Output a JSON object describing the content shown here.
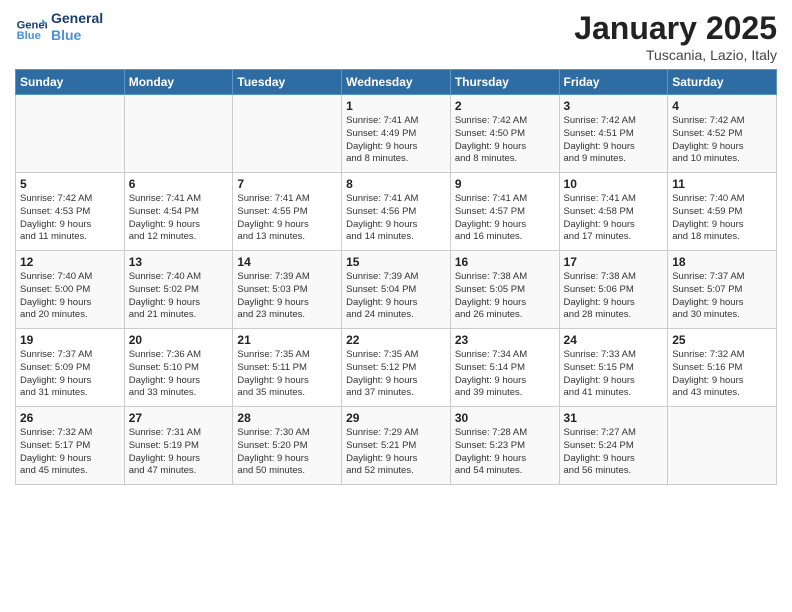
{
  "header": {
    "logo_line1": "General",
    "logo_line2": "Blue",
    "month": "January 2025",
    "location": "Tuscania, Lazio, Italy"
  },
  "weekdays": [
    "Sunday",
    "Monday",
    "Tuesday",
    "Wednesday",
    "Thursday",
    "Friday",
    "Saturday"
  ],
  "weeks": [
    [
      {
        "day": "",
        "text": ""
      },
      {
        "day": "",
        "text": ""
      },
      {
        "day": "",
        "text": ""
      },
      {
        "day": "1",
        "text": "Sunrise: 7:41 AM\nSunset: 4:49 PM\nDaylight: 9 hours\nand 8 minutes."
      },
      {
        "day": "2",
        "text": "Sunrise: 7:42 AM\nSunset: 4:50 PM\nDaylight: 9 hours\nand 8 minutes."
      },
      {
        "day": "3",
        "text": "Sunrise: 7:42 AM\nSunset: 4:51 PM\nDaylight: 9 hours\nand 9 minutes."
      },
      {
        "day": "4",
        "text": "Sunrise: 7:42 AM\nSunset: 4:52 PM\nDaylight: 9 hours\nand 10 minutes."
      }
    ],
    [
      {
        "day": "5",
        "text": "Sunrise: 7:42 AM\nSunset: 4:53 PM\nDaylight: 9 hours\nand 11 minutes."
      },
      {
        "day": "6",
        "text": "Sunrise: 7:41 AM\nSunset: 4:54 PM\nDaylight: 9 hours\nand 12 minutes."
      },
      {
        "day": "7",
        "text": "Sunrise: 7:41 AM\nSunset: 4:55 PM\nDaylight: 9 hours\nand 13 minutes."
      },
      {
        "day": "8",
        "text": "Sunrise: 7:41 AM\nSunset: 4:56 PM\nDaylight: 9 hours\nand 14 minutes."
      },
      {
        "day": "9",
        "text": "Sunrise: 7:41 AM\nSunset: 4:57 PM\nDaylight: 9 hours\nand 16 minutes."
      },
      {
        "day": "10",
        "text": "Sunrise: 7:41 AM\nSunset: 4:58 PM\nDaylight: 9 hours\nand 17 minutes."
      },
      {
        "day": "11",
        "text": "Sunrise: 7:40 AM\nSunset: 4:59 PM\nDaylight: 9 hours\nand 18 minutes."
      }
    ],
    [
      {
        "day": "12",
        "text": "Sunrise: 7:40 AM\nSunset: 5:00 PM\nDaylight: 9 hours\nand 20 minutes."
      },
      {
        "day": "13",
        "text": "Sunrise: 7:40 AM\nSunset: 5:02 PM\nDaylight: 9 hours\nand 21 minutes."
      },
      {
        "day": "14",
        "text": "Sunrise: 7:39 AM\nSunset: 5:03 PM\nDaylight: 9 hours\nand 23 minutes."
      },
      {
        "day": "15",
        "text": "Sunrise: 7:39 AM\nSunset: 5:04 PM\nDaylight: 9 hours\nand 24 minutes."
      },
      {
        "day": "16",
        "text": "Sunrise: 7:38 AM\nSunset: 5:05 PM\nDaylight: 9 hours\nand 26 minutes."
      },
      {
        "day": "17",
        "text": "Sunrise: 7:38 AM\nSunset: 5:06 PM\nDaylight: 9 hours\nand 28 minutes."
      },
      {
        "day": "18",
        "text": "Sunrise: 7:37 AM\nSunset: 5:07 PM\nDaylight: 9 hours\nand 30 minutes."
      }
    ],
    [
      {
        "day": "19",
        "text": "Sunrise: 7:37 AM\nSunset: 5:09 PM\nDaylight: 9 hours\nand 31 minutes."
      },
      {
        "day": "20",
        "text": "Sunrise: 7:36 AM\nSunset: 5:10 PM\nDaylight: 9 hours\nand 33 minutes."
      },
      {
        "day": "21",
        "text": "Sunrise: 7:35 AM\nSunset: 5:11 PM\nDaylight: 9 hours\nand 35 minutes."
      },
      {
        "day": "22",
        "text": "Sunrise: 7:35 AM\nSunset: 5:12 PM\nDaylight: 9 hours\nand 37 minutes."
      },
      {
        "day": "23",
        "text": "Sunrise: 7:34 AM\nSunset: 5:14 PM\nDaylight: 9 hours\nand 39 minutes."
      },
      {
        "day": "24",
        "text": "Sunrise: 7:33 AM\nSunset: 5:15 PM\nDaylight: 9 hours\nand 41 minutes."
      },
      {
        "day": "25",
        "text": "Sunrise: 7:32 AM\nSunset: 5:16 PM\nDaylight: 9 hours\nand 43 minutes."
      }
    ],
    [
      {
        "day": "26",
        "text": "Sunrise: 7:32 AM\nSunset: 5:17 PM\nDaylight: 9 hours\nand 45 minutes."
      },
      {
        "day": "27",
        "text": "Sunrise: 7:31 AM\nSunset: 5:19 PM\nDaylight: 9 hours\nand 47 minutes."
      },
      {
        "day": "28",
        "text": "Sunrise: 7:30 AM\nSunset: 5:20 PM\nDaylight: 9 hours\nand 50 minutes."
      },
      {
        "day": "29",
        "text": "Sunrise: 7:29 AM\nSunset: 5:21 PM\nDaylight: 9 hours\nand 52 minutes."
      },
      {
        "day": "30",
        "text": "Sunrise: 7:28 AM\nSunset: 5:23 PM\nDaylight: 9 hours\nand 54 minutes."
      },
      {
        "day": "31",
        "text": "Sunrise: 7:27 AM\nSunset: 5:24 PM\nDaylight: 9 hours\nand 56 minutes."
      },
      {
        "day": "",
        "text": ""
      }
    ]
  ]
}
